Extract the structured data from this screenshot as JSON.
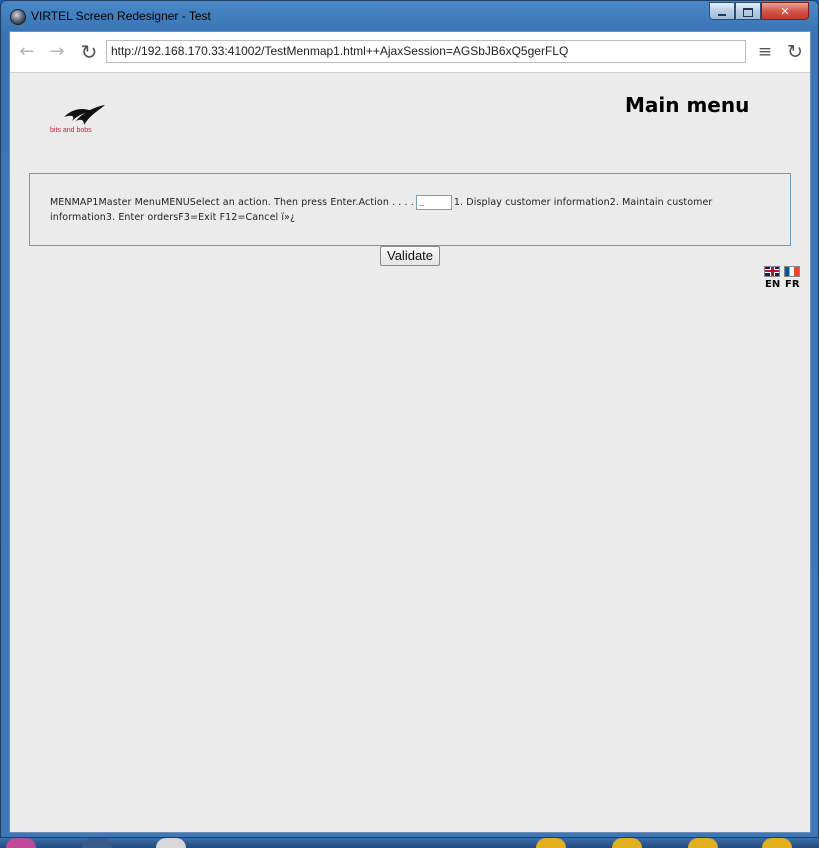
{
  "window": {
    "title": "VIRTEL Screen Redesigner - Test",
    "controls": {
      "minimize": "minimize-icon",
      "maximize": "maximize-icon",
      "close": "✕"
    }
  },
  "browser": {
    "back_icon": "←",
    "forward_icon": "→",
    "reload_icon": "↻",
    "url": "http://192.168.170.33:41002/TestMenmap1.html++AjaxSession=AGSbJB6xQ5gerFLQ",
    "menu_icon": "≡"
  },
  "page": {
    "logo_text": "bits and bobs",
    "title": "Main menu",
    "screen": {
      "text_before": "MENMAP1Master MenuMENUSelect an action. Then press Enter.Action . . . .",
      "action_value": "_",
      "text_after": "1. Display customer information2. Maintain customer information3. Enter ordersF3=Exit F12=Cancel ï»¿"
    },
    "validate_label": "Validate",
    "languages": [
      {
        "flag": "uk-flag-icon",
        "label": "EN"
      },
      {
        "flag": "fr-flag-icon",
        "label": "FR"
      }
    ]
  },
  "colors": {
    "logo": "#d0203a",
    "panel_border": "#6a9ac2",
    "page_bg": "#ebebeb"
  }
}
